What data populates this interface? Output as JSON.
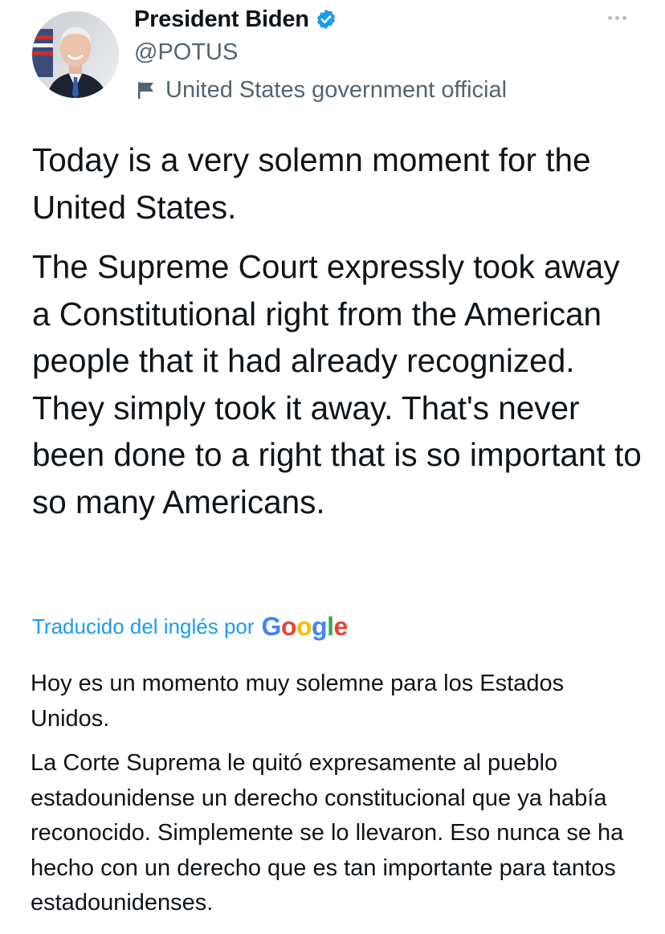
{
  "author": {
    "display_name": "President Biden",
    "handle": "@POTUS",
    "label": "United States government official",
    "verified": true
  },
  "tweet": {
    "paragraphs": [
      "Today is a very solemn moment for the United States.",
      "The Supreme Court expressly took away a Constitutional right from the American people that it had already recognized. They simply took it away. That's never been done to a right that is so important to so many Americans."
    ]
  },
  "translation": {
    "label": "Traducido del inglés por",
    "provider": "Google",
    "paragraphs": [
      "Hoy es un momento muy solemne para los Estados Unidos.",
      " La Corte Suprema le quitó expresamente al pueblo estadounidense un derecho constitucional que ya había reconocido. Simplemente se lo llevaron. Eso nunca se ha hecho con un derecho que es tan importante para tantos estadounidenses."
    ]
  },
  "icons": {
    "verified": "verified-badge-icon",
    "label": "flag-icon",
    "more": "more-icon"
  },
  "colors": {
    "accent": "#1d9bf0",
    "text_primary": "#0f1419",
    "text_secondary": "#536471"
  }
}
